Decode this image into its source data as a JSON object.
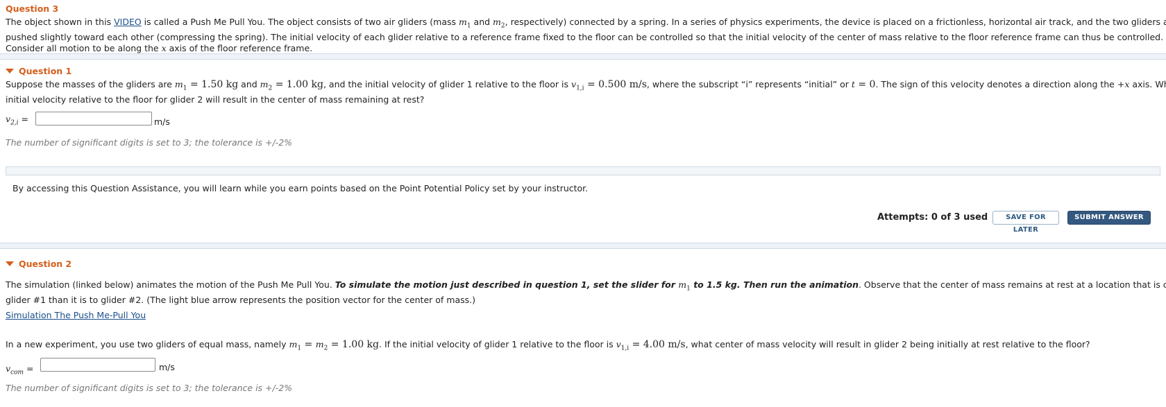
{
  "q3": {
    "title": "Question 3",
    "intro_a": "The object shown in this ",
    "video_link": "VIDEO",
    "intro_b": " is called a Push Me Pull You. The object consists of two air gliders (mass ",
    "m1": "m",
    "m1_sub": "1",
    "and": " and ",
    "m2": "m",
    "m2_sub": "2",
    "intro_c": ", respectively) connected by a spring. In a series of physics experiments, the device is placed on a frictionless, horizontal air track, and the two gliders are",
    "intro_line2": "pushed slightly toward each other (compressing the spring). The initial velocity of each glider relative to a reference frame fixed to the floor can be controlled so that the initial velocity of the center of mass relative to the floor reference frame can thus be controlled.",
    "intro_line3_a": "Consider all motion to be along the ",
    "intro_line3_x": "x",
    "intro_line3_b": " axis of the floor reference frame."
  },
  "q1": {
    "title": "Question 1",
    "t1": "Suppose the masses of the gliders are ",
    "m1_eq": " = 1.50 kg",
    "t2": " and ",
    "m2_eq": " = 1.00 kg",
    "t3": ", and the initial velocity of glider 1 relative to the floor is ",
    "v": "v",
    "v_sub": "1,i",
    "v_eq": " = 0.500 m/s",
    "t4": ", where the subscript “i” represents “initial” or ",
    "t_var": "t",
    "t_eq": " = 0",
    "t5": ". The sign of this velocity denotes a direction along the +",
    "x": "x",
    "t6": " axis. What",
    "line2": "initial velocity relative to the floor for glider 2 will result in the center of mass remaining at rest?",
    "ans_label": "v",
    "ans_sub": "2,i",
    "ans_eq": " =",
    "ans_value": "",
    "ans_unit": "m/s",
    "hint": "The number of significant digits is set to 3; the tolerance is +/-2%"
  },
  "assist": {
    "text": "By accessing this Question Assistance, you will learn while you earn points based on the Point Potential Policy set by your instructor.",
    "attempts": "Attempts: 0 of 3 used",
    "save": "SAVE FOR LATER",
    "submit": "SUBMIT ANSWER"
  },
  "q2": {
    "title": "Question 2",
    "p1_a": "The simulation (linked below) animates the motion of the Push Me Pull You. ",
    "p1_bold_a": "To simulate the motion just described in question 1, set the slider for ",
    "p1_bold_m": "m",
    "p1_bold_sub": "1",
    "p1_bold_b": " to 1.5 kg. Then run the animation",
    "p1_b": ". Observe that the center of mass remains at rest at a location that is closer to",
    "p1_line2": "glider #1 than it is to glider #2. (The light blue arrow represents the position vector for the center of mass.)",
    "sim_link": "Simulation The Push Me-Pull You",
    "p2_a": "In a new experiment, you use two gliders of equal mass, namely ",
    "p2_eq": " = 1.00 kg",
    "p2_b": ". If the initial velocity of glider 1 relative to the floor is ",
    "p2_veq": " = 4.00 m/s",
    "p2_c": ", what center of mass velocity will result in glider 2 being initially at rest relative to the floor?",
    "ans_label": "v",
    "ans_sub": "com",
    "ans_eq": " =",
    "ans_value": "",
    "ans_unit": "m/s",
    "hint": "The number of significant digits is set to 3; the tolerance is +/-2%"
  },
  "colors": {
    "accent_orange": "#d35f1b",
    "link_blue": "#1a4f8b",
    "button_navy": "#34587f"
  }
}
